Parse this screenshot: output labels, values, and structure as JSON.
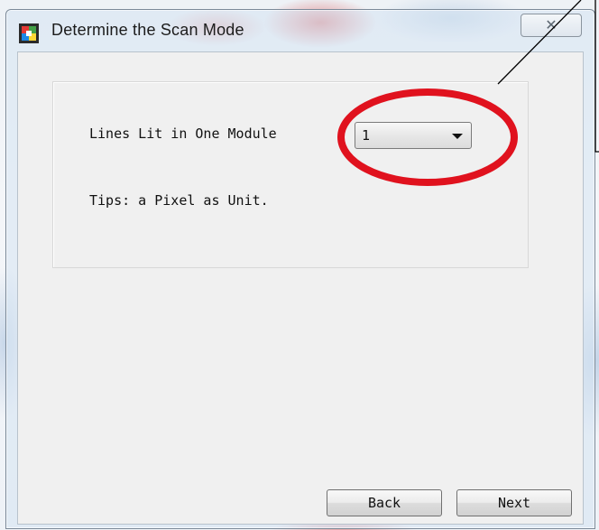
{
  "window": {
    "title": "Determine the Scan Mode",
    "close_symbol": "✕"
  },
  "form": {
    "lines_lit_label": "Lines Lit in One Module",
    "lines_lit_value": "1",
    "tips": "Tips: a Pixel as Unit."
  },
  "buttons": {
    "back_label": "Back",
    "next_label": "Next"
  },
  "icons": {
    "app": "app-logo-icon",
    "close": "close-icon",
    "dropdown": "chevron-down-icon"
  },
  "colors": {
    "annotation_red": "#e0121e",
    "annotation_line": "#000000"
  }
}
